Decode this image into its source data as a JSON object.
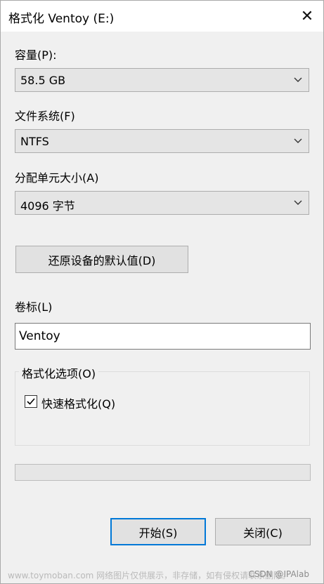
{
  "window": {
    "title": "格式化 Ventoy (E:)",
    "close_glyph": "✕"
  },
  "capacity": {
    "label": "容量(P):",
    "value": "58.5 GB"
  },
  "filesystem": {
    "label": "文件系统(F)",
    "value": "NTFS"
  },
  "allocation": {
    "label": "分配单元大小(A)",
    "value": "4096 字节"
  },
  "restore_button": {
    "label": "还原设备的默认值(D)"
  },
  "volume": {
    "label": "卷标(L)",
    "value": "Ventoy"
  },
  "format_options": {
    "title": "格式化选项(O)",
    "quick_format": {
      "label": "快速格式化(Q)",
      "checked": true
    }
  },
  "progress": {
    "fraction": 0
  },
  "buttons": {
    "start": "开始(S)",
    "close": "关闭(C)"
  },
  "watermark": {
    "left": "www.toymoban.com 网络图片仅供展示，非存储，如有侵权请联系删除。",
    "right": "CSDN @IPAlab"
  },
  "icons": {
    "close": "close-icon",
    "dropdown": "chevron-down-icon",
    "check": "checkmark-icon"
  },
  "colors": {
    "default_button_border": "#0078d7",
    "window_bg": "#f0f0f0",
    "titlebar_bg": "#ffffff"
  }
}
